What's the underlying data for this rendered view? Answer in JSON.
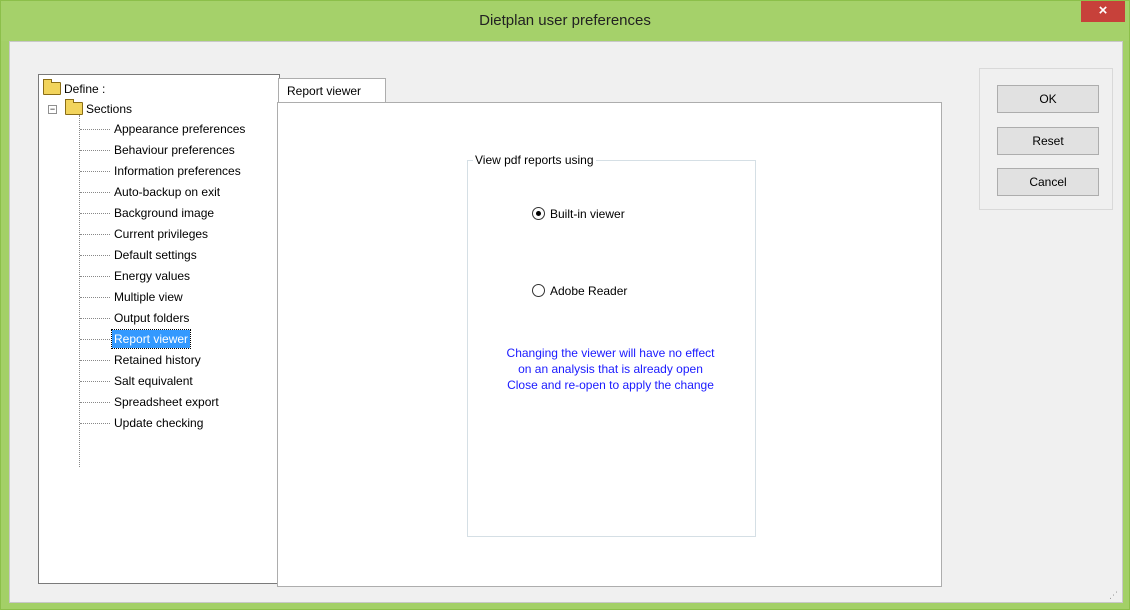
{
  "window": {
    "title": "Dietplan user preferences",
    "close_glyph": "×"
  },
  "tree": {
    "root_label": "Define :",
    "sections_label": "Sections",
    "items": [
      {
        "label": "Appearance preferences",
        "selected": false
      },
      {
        "label": "Behaviour preferences",
        "selected": false
      },
      {
        "label": "Information preferences",
        "selected": false
      },
      {
        "label": "Auto-backup on exit",
        "selected": false
      },
      {
        "label": "Background image",
        "selected": false
      },
      {
        "label": "Current privileges",
        "selected": false
      },
      {
        "label": "Default settings",
        "selected": false
      },
      {
        "label": "Energy values",
        "selected": false
      },
      {
        "label": "Multiple view",
        "selected": false
      },
      {
        "label": "Output folders",
        "selected": false
      },
      {
        "label": "Report viewer",
        "selected": true
      },
      {
        "label": "Retained history",
        "selected": false
      },
      {
        "label": "Salt equivalent",
        "selected": false
      },
      {
        "label": "Spreadsheet export",
        "selected": false
      },
      {
        "label": "Update checking",
        "selected": false
      }
    ]
  },
  "tab": {
    "label": "Report viewer"
  },
  "viewer_group": {
    "legend": "View pdf reports using",
    "options": [
      {
        "label": "Built-in viewer",
        "checked": true
      },
      {
        "label": "Adobe Reader",
        "checked": false
      }
    ],
    "note_lines": [
      "Changing the viewer will have no effect",
      "on an analysis that is already open",
      "Close and re-open to apply the change"
    ]
  },
  "buttons": {
    "ok": "OK",
    "reset": "Reset",
    "cancel": "Cancel"
  },
  "colors": {
    "title_bar": "#a5d16a",
    "close_button": "#c7413a",
    "note_text": "#1a1aff",
    "selection": "#3399ff"
  }
}
